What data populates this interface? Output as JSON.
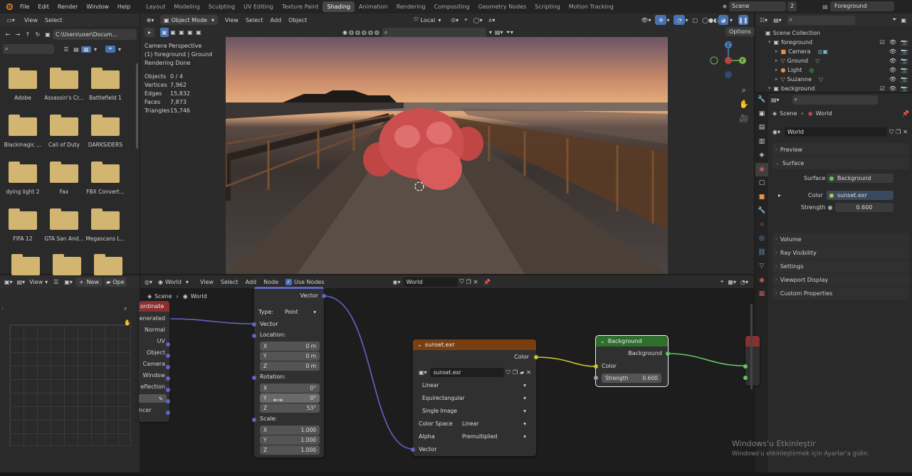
{
  "topbar": {
    "menus": [
      "File",
      "Edit",
      "Render",
      "Window",
      "Help"
    ],
    "workspaces": [
      "Layout",
      "Modeling",
      "Sculpting",
      "UV Editing",
      "Texture Paint",
      "Shading",
      "Animation",
      "Rendering",
      "Compositing",
      "Geometry Nodes",
      "Scripting",
      "Motion Tracking"
    ],
    "active_workspace": "Shading",
    "scene": "Scene",
    "view_layer": "Foreground",
    "scene_users": "2"
  },
  "filebrowser": {
    "menu_view": "View",
    "menu_select": "Select",
    "path": "C:\\Users\\user\\Docum...",
    "items": [
      "Adobe",
      "Assassin's Cr...",
      "Battlefield 1",
      "Blackmagic ...",
      "Call of Duty",
      "DARKSiDERS",
      "dying light 2",
      "Fax",
      "FBX Convert...",
      "FIFA 12",
      "GTA San And...",
      "Megascans L..."
    ]
  },
  "viewport": {
    "mode": "Object Mode",
    "menus": [
      "View",
      "Select",
      "Add",
      "Object"
    ],
    "orientation": "Local",
    "options": "Options",
    "overlay_lines": [
      "Camera Perspective",
      "(1) foreground | Ground",
      "Rendering Done"
    ],
    "stats": [
      {
        "label": "Objects",
        "value": "0 / 4"
      },
      {
        "label": "Vertices",
        "value": "7,962"
      },
      {
        "label": "Edges",
        "value": "15,832"
      },
      {
        "label": "Faces",
        "value": "7,873"
      },
      {
        "label": "Triangles",
        "value": "15,746"
      }
    ]
  },
  "outliner": {
    "root": "Scene Collection",
    "items": [
      {
        "name": "foreground",
        "level": 1
      },
      {
        "name": "Camera",
        "level": 2
      },
      {
        "name": "Ground",
        "level": 2
      },
      {
        "name": "Light",
        "level": 2
      },
      {
        "name": "Suzanne",
        "level": 2
      },
      {
        "name": "background",
        "level": 1
      }
    ]
  },
  "properties": {
    "breadcrumb_scene": "Scene",
    "breadcrumb_world": "World",
    "world_name": "World",
    "sections": [
      "Preview",
      "Surface",
      "Volume",
      "Ray Visibility",
      "Settings",
      "Viewport Display",
      "Custom Properties"
    ],
    "surface_label": "Surface",
    "surface_value": "Background",
    "color_label": "Color",
    "color_value": "sunset.exr",
    "strength_label": "Strength",
    "strength_value": "0.600"
  },
  "image_editor": {
    "view": "View",
    "new": "New",
    "open": "Ope"
  },
  "node_editor": {
    "world_label": "World",
    "menus": [
      "View",
      "Select",
      "Add",
      "Node"
    ],
    "use_nodes": "Use Nodes",
    "world_name": "World",
    "breadcrumb_scene": "Scene",
    "breadcrumb_world": "World",
    "texcoord": {
      "title": "ordinate",
      "outputs": [
        "enerated",
        "Normal",
        "UV",
        "Object",
        "Camera",
        "Window",
        "eflection"
      ],
      "bottom": "ncer"
    },
    "mapping": {
      "vector_out": "Vector",
      "type_label": "Type:",
      "type_value": "Point",
      "vector_in": "Vector",
      "location_label": "Location:",
      "location": [
        {
          "axis": "X",
          "value": "0 m"
        },
        {
          "axis": "Y",
          "value": "0 m"
        },
        {
          "axis": "Z",
          "value": "0 m"
        }
      ],
      "rotation_label": "Rotation:",
      "rotation": [
        {
          "axis": "X",
          "value": "0°"
        },
        {
          "axis": "Y",
          "value": "0°"
        },
        {
          "axis": "Z",
          "value": "53°"
        }
      ],
      "scale_label": "Scale:",
      "scale": [
        {
          "axis": "X",
          "value": "1.000"
        },
        {
          "axis": "Y",
          "value": "1.000"
        },
        {
          "axis": "Z",
          "value": "1.000"
        }
      ]
    },
    "envtex": {
      "title": "sunset.exr",
      "color_out": "Color",
      "image": "sunset.exr",
      "interpolation": "Linear",
      "projection": "Equirectangular",
      "source": "Single Image",
      "colorspace_label": "Color Space",
      "colorspace_value": "Linear",
      "alpha_label": "Alpha",
      "alpha_value": "Premultiplied",
      "vector_in": "Vector"
    },
    "background": {
      "title": "Background",
      "out": "Background",
      "color": "Color",
      "strength_label": "Strength",
      "strength_value": "0.600"
    }
  },
  "watermark": {
    "line1": "Windows'u Etkinleştir",
    "line2": "Windows'u etkinleştirmek için Ayarlar'a gidin."
  },
  "colors": {
    "accent_blue": "#4772b3",
    "env_header": "#7a3f10",
    "bg_header": "#2e6f2e",
    "texcoord_header": "#8a2e2e"
  }
}
